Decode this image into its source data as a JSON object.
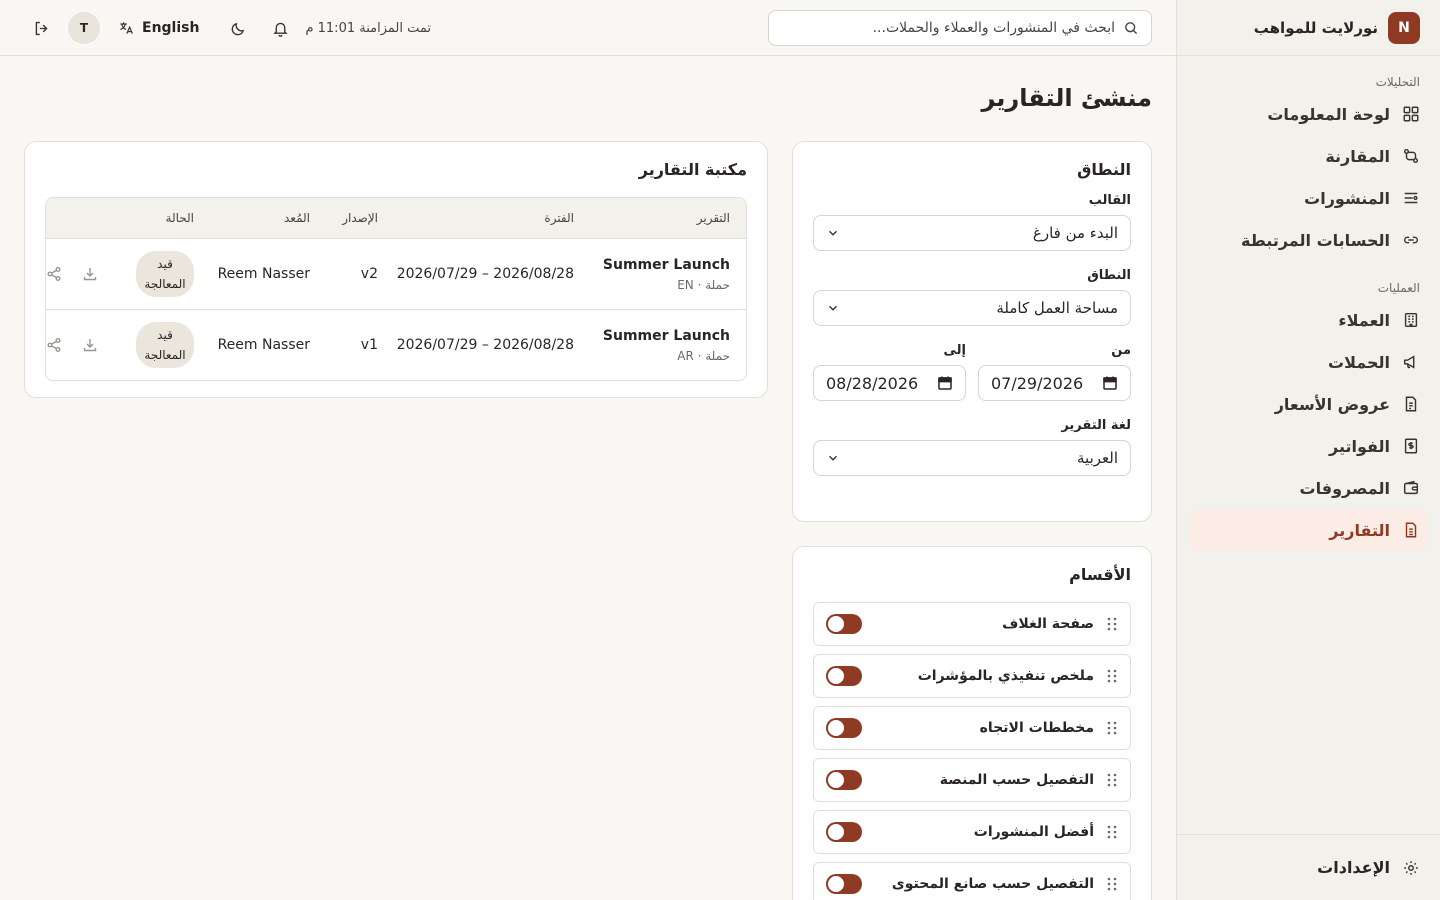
{
  "brand": {
    "logo": "N",
    "name": "نورلايت للمواهب"
  },
  "sidebar": {
    "sections": [
      {
        "title": "التحليلات",
        "items": [
          {
            "label": "لوحة المعلومات",
            "icon": "dashboard-icon"
          },
          {
            "label": "المقارنة",
            "icon": "compare-icon"
          },
          {
            "label": "المنشورات",
            "icon": "posts-icon"
          },
          {
            "label": "الحسابات المرتبطة",
            "icon": "link-icon"
          }
        ]
      },
      {
        "title": "العمليات",
        "items": [
          {
            "label": "العملاء",
            "icon": "building-icon"
          },
          {
            "label": "الحملات",
            "icon": "megaphone-icon"
          },
          {
            "label": "عروض الأسعار",
            "icon": "quote-document-icon"
          },
          {
            "label": "الفواتير",
            "icon": "invoice-icon"
          },
          {
            "label": "المصروفات",
            "icon": "wallet-icon"
          },
          {
            "label": "التقارير",
            "icon": "report-icon",
            "active": true
          }
        ]
      }
    ],
    "footer": {
      "label": "الإعدادات",
      "icon": "gear-icon"
    }
  },
  "topbar": {
    "search_placeholder": "ابحث في المنشورات والعملاء والحملات...",
    "sync_status": "تمت المزامنة 11:01 م",
    "language": "English",
    "avatar": "T"
  },
  "page": {
    "title": "منشئ التقارير"
  },
  "scope": {
    "title": "النطاق",
    "template_label": "القالب",
    "template_value": "البدء من فارغ",
    "scope_label": "النطاق",
    "scope_value": "مساحة العمل كاملة",
    "from_label": "من",
    "from_value": "07/29/2026",
    "to_label": "إلى",
    "to_value": "08/28/2026",
    "language_label": "لغة التقرير",
    "language_value": "العربية"
  },
  "sections": {
    "title": "الأقسام",
    "items": [
      {
        "label": "صفحة الغلاف",
        "enabled": true
      },
      {
        "label": "ملخص تنفيذي بالمؤشرات",
        "enabled": true
      },
      {
        "label": "مخططات الاتجاه",
        "enabled": true
      },
      {
        "label": "التفصيل حسب المنصة",
        "enabled": true
      },
      {
        "label": "أفضل المنشورات",
        "enabled": true
      },
      {
        "label": "التفصيل حسب صانع المحتوى",
        "enabled": true
      }
    ]
  },
  "library": {
    "title": "مكتبة التقارير",
    "columns": [
      "التقرير",
      "الفترة",
      "الإصدار",
      "المُعد",
      "الحالة"
    ],
    "rows": [
      {
        "name": "Summer Launch",
        "meta": "حملة · EN",
        "period": "2026/07/29 – 2026/08/28",
        "version": "v2",
        "owner": "Reem Nasser",
        "status": "قيد المعالجة"
      },
      {
        "name": "Summer Launch",
        "meta": "حملة · AR",
        "period": "2026/07/29 – 2026/08/28",
        "version": "v1",
        "owner": "Reem Nasser",
        "status": "قيد المعالجة"
      }
    ]
  },
  "colors": {
    "accent": "#8f3a22",
    "active_bg": "#fbece6",
    "background": "#f8f7f4"
  }
}
